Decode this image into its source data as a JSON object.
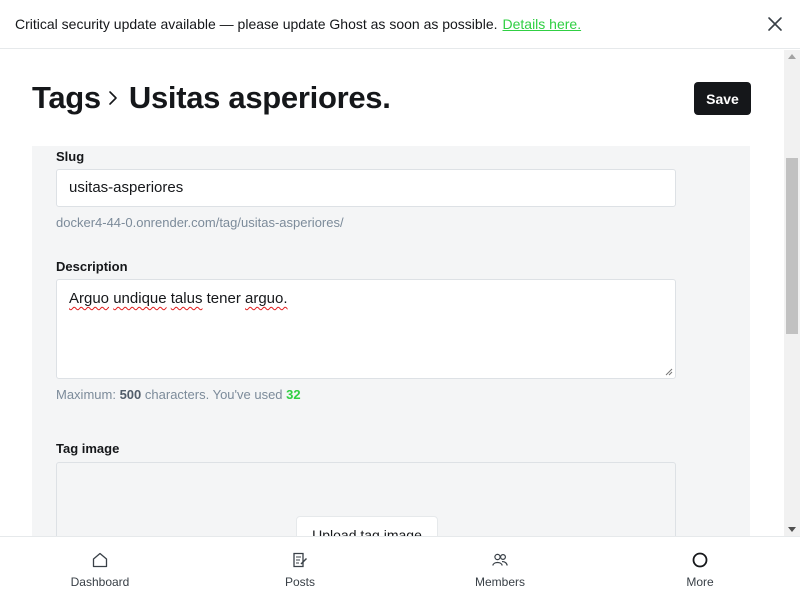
{
  "banner": {
    "message": "Critical security update available — please update Ghost as soon as possible.",
    "link_text": "Details here."
  },
  "header": {
    "breadcrumb_root": "Tags",
    "breadcrumb_current": "Usitas asperiores.",
    "save_label": "Save"
  },
  "form": {
    "slug": {
      "label": "Slug",
      "value": "usitas-asperiores",
      "url_hint": "docker4-44-0.onrender.com/tag/usitas-asperiores/"
    },
    "description": {
      "label": "Description",
      "value": "Arguo undique talus tener arguo.",
      "words": [
        "Arguo",
        "undique",
        "talus",
        "tener",
        "arguo."
      ],
      "hint_prefix": "Maximum:",
      "max_chars": "500",
      "hint_middle": "characters. You've used",
      "used_chars": "32"
    },
    "tag_image": {
      "label": "Tag image",
      "upload_label": "Upload tag image"
    }
  },
  "bottom_nav": {
    "items": [
      {
        "label": "Dashboard",
        "icon": "house-icon"
      },
      {
        "label": "Posts",
        "icon": "edit-posts-icon"
      },
      {
        "label": "Members",
        "icon": "members-icon"
      },
      {
        "label": "More",
        "icon": "circle-icon"
      }
    ]
  },
  "colors": {
    "accent_green": "#30cf43",
    "primary_dark": "#15171a",
    "panel_bg": "#f4f5f6"
  }
}
